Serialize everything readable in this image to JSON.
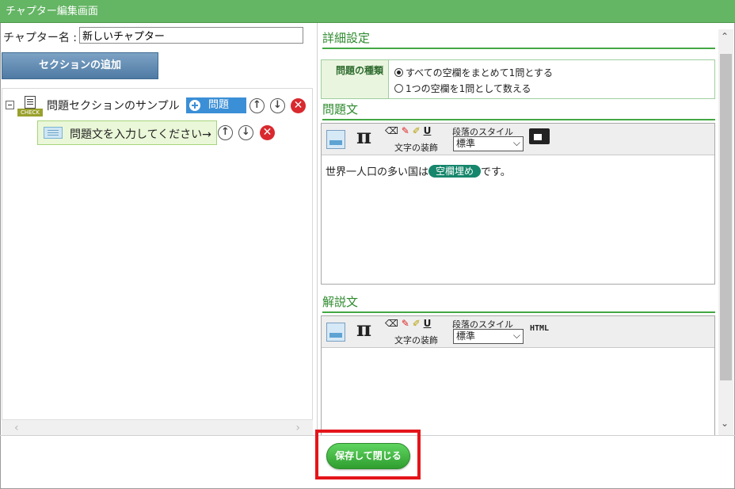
{
  "window": {
    "title": "チャプター編集画面"
  },
  "left": {
    "name_label": "チャプター名 :",
    "name_value": "新しいチャプター",
    "add_section_label": "セクションの追加",
    "tree": {
      "section": {
        "label": "問題セクションのサンプル",
        "badge": "CHECK",
        "add_question_label": "問題"
      },
      "question": {
        "label": "問題文を入力してください→"
      }
    }
  },
  "right": {
    "details_heading": "詳細設定",
    "question_type_label": "問題の種類",
    "radio_options": [
      {
        "label": "すべての空欄をまとめて1問とする",
        "checked": true
      },
      {
        "label": "1つの空欄を1問として数える",
        "checked": false
      }
    ],
    "question_heading": "問題文",
    "explanation_heading": "解説文",
    "toolbar": {
      "pi": "π",
      "decoration_label": "文字の装飾",
      "underline": "U",
      "paragraph_style_label": "段落のスタイル",
      "paragraph_style_value": "標準",
      "html_label": "HTML"
    },
    "question_body": {
      "before": "世界一人口の多い国は",
      "blank": "空欄埋め",
      "after": "です。"
    }
  },
  "footer": {
    "save_close_label": "保存して閉じる"
  },
  "colors": {
    "title_bar": "#64b564",
    "accent_green": "#2d8a2d",
    "save_button": "#3cb43c",
    "highlight": "#e4151b",
    "add_button": "#4f7aa3"
  }
}
